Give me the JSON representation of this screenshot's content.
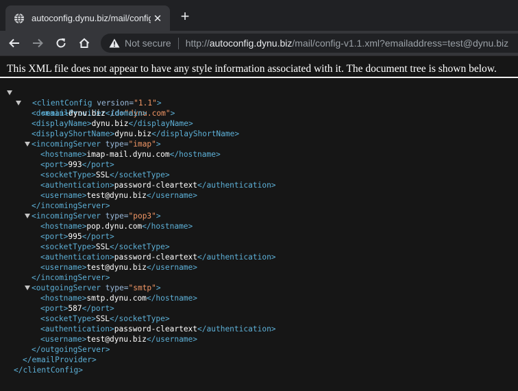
{
  "tab": {
    "title": "autoconfig.dynu.biz/mail/config-",
    "close_glyph": "✕",
    "favicon": "globe-icon"
  },
  "newtab_glyph": "+",
  "toolbar": {
    "security_label": "Not secure",
    "url_scheme": "http://",
    "url_host": "autoconfig.dynu.biz",
    "url_path": "/mail/config-v1.1.xml?emailaddress=test@dynu.biz"
  },
  "banner": "This XML file does not appear to have any style information associated with it. The document tree is shown below.",
  "colors": {
    "tag": "#5db0d7",
    "attr_name": "#9bbbdc",
    "attr_value": "#f29766",
    "text": "#ffffff",
    "background": "#161616"
  },
  "xml": {
    "root": {
      "open": "<clientConfig",
      "attr": "version=",
      "value": "\"1.1\"",
      "close": "</clientConfig>"
    },
    "provider": {
      "open": "<emailProvider",
      "attr": "id=",
      "value": "\"dynu.com\"",
      "close": "</emailProvider>"
    },
    "domain": "dynu.biz",
    "displayName": "dynu.biz",
    "displayShortName": "dynu.biz",
    "servers": [
      {
        "tag": "incomingServer",
        "type": "\"imap\"",
        "hostname": "imap-mail.dynu.com",
        "port": "993",
        "socketType": "SSL",
        "authentication": "password-cleartext",
        "username": "test@dynu.biz"
      },
      {
        "tag": "incomingServer",
        "type": "\"pop3\"",
        "hostname": "pop.dynu.com",
        "port": "995",
        "socketType": "SSL",
        "authentication": "password-cleartext",
        "username": "test@dynu.biz"
      },
      {
        "tag": "outgoingServer",
        "type": "\"smtp\"",
        "hostname": "smtp.dynu.com",
        "port": "587",
        "socketType": "SSL",
        "authentication": "password-cleartext",
        "username": "test@dynu.biz"
      }
    ]
  }
}
